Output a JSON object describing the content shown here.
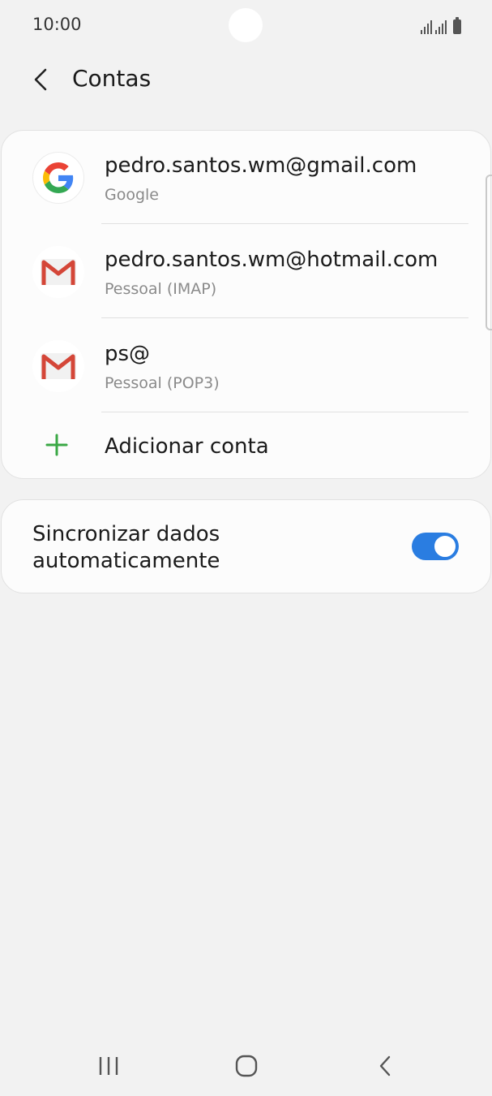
{
  "status_bar": {
    "time": "10:00"
  },
  "header": {
    "title": "Contas",
    "back_icon": "chevron-left-icon"
  },
  "accounts": [
    {
      "name": "pedro.santos.wm@gmail.com",
      "type": "Google",
      "icon": "google-icon"
    },
    {
      "name": "pedro.santos.wm@hotmail.com",
      "type": "Pessoal (IMAP)",
      "icon": "gmail-icon"
    },
    {
      "name": "ps@",
      "type": "Pessoal (POP3)",
      "icon": "gmail-icon"
    }
  ],
  "add_account": {
    "label": "Adicionar conta",
    "icon": "plus-icon"
  },
  "sync": {
    "label": "Sincronizar dados automaticamente",
    "enabled": true
  },
  "colors": {
    "background": "#f2f2f2",
    "card": "#fcfcfc",
    "accent": "#2a7de1",
    "add_green": "#3aa845",
    "gmail_red": "#d44638"
  }
}
